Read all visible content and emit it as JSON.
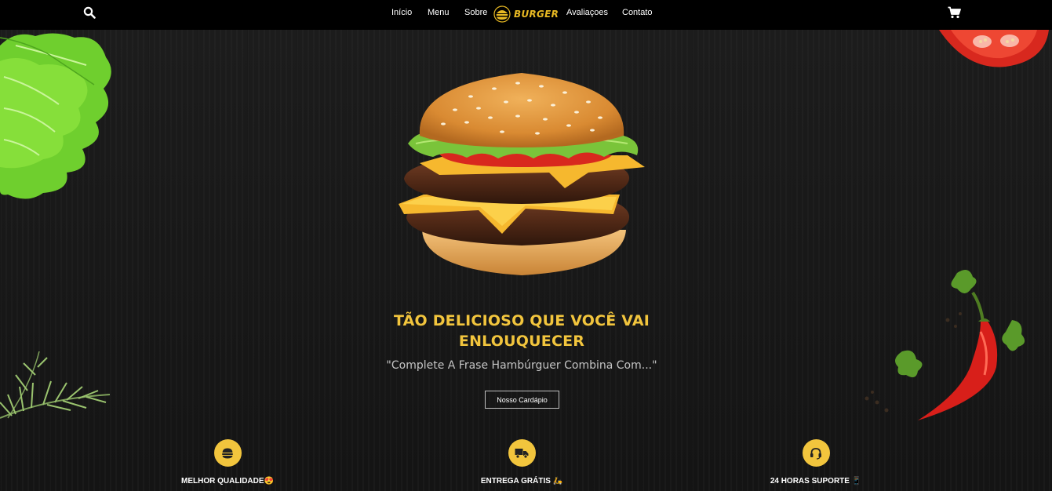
{
  "nav": {
    "links": [
      "Início",
      "Menu",
      "Sobre",
      "Avaliaçoes",
      "Contato"
    ],
    "logo_text": "BURGER",
    "search_icon": "search-icon",
    "cart_icon": "cart-icon"
  },
  "hero": {
    "headline": "TÃO DELICIOSO QUE VOCÊ VAI ENLOUQUECER",
    "subline": "\"Complete A Frase Hambúrguer Combina Com...\"",
    "cta_label": "Nosso Cardápio"
  },
  "features": [
    {
      "label": "MELHOR QUALIDADE😍",
      "icon": "burger-icon"
    },
    {
      "label": "ENTREGA GRÁTIS 🛵",
      "icon": "truck-icon"
    },
    {
      "label": "24 HORAS SUPORTE 📱",
      "icon": "headset-icon"
    }
  ],
  "colors": {
    "accent": "#f2c53d",
    "navbar": "#000000",
    "background": "#181818"
  }
}
